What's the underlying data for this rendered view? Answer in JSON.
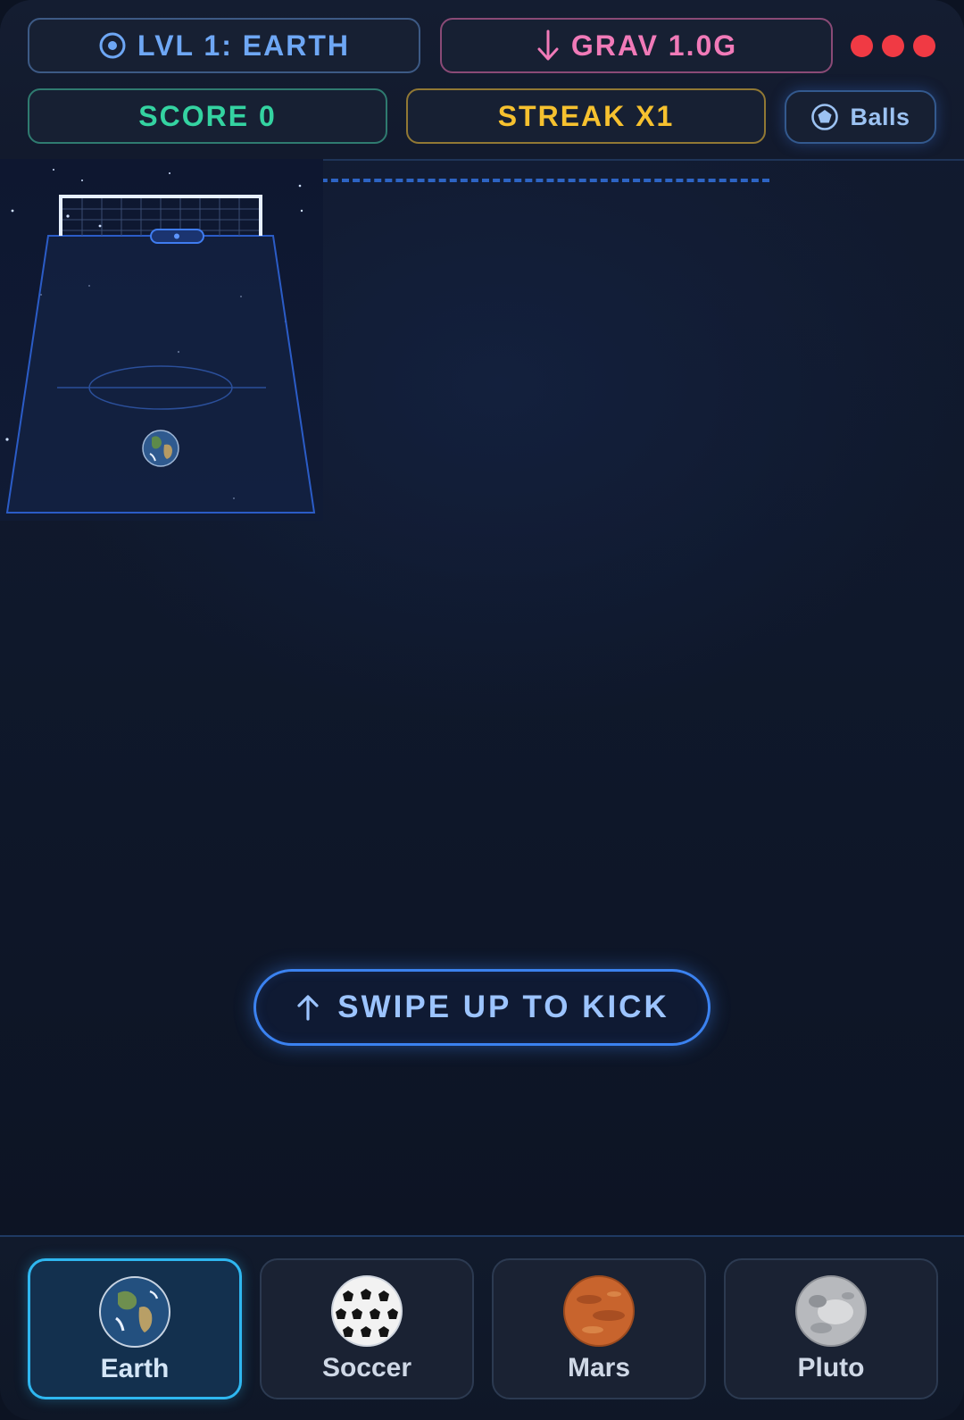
{
  "hud": {
    "level_label": "LVL 1: EARTH",
    "gravity_label": "GRAV 1.0G",
    "score_label": "SCORE 0",
    "streak_label": "STREAK X1",
    "balls_button_label": "Balls",
    "lives_remaining": 3,
    "icons": {
      "level": "target-icon",
      "gravity": "arrow-down-icon",
      "balls": "soccer-ball-icon"
    },
    "colors": {
      "level": "#6ea7f5",
      "gravity": "#f07ab8",
      "score": "#34d3a1",
      "streak": "#f6c12f",
      "lives": "#f03a44"
    }
  },
  "game": {
    "ball": "earth",
    "prompt_label": "SWIPE UP TO KICK",
    "prompt_icon": "arrow-up-icon"
  },
  "ball_selector": {
    "selected": "Earth",
    "items": [
      {
        "label": "Earth",
        "icon": "earth-ball-icon"
      },
      {
        "label": "Soccer",
        "icon": "soccer-ball-icon"
      },
      {
        "label": "Mars",
        "icon": "mars-ball-icon"
      },
      {
        "label": "Pluto",
        "icon": "pluto-ball-icon"
      }
    ]
  }
}
